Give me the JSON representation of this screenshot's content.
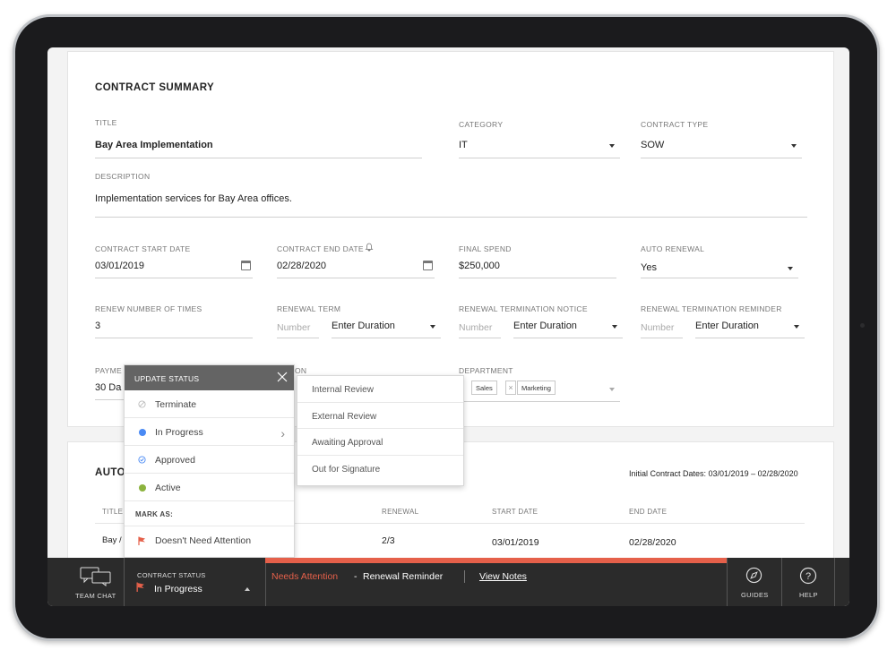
{
  "summary": {
    "heading": "CONTRACT SUMMARY",
    "title": {
      "label": "TITLE",
      "value": "Bay Area Implementation"
    },
    "category": {
      "label": "CATEGORY",
      "value": "IT"
    },
    "contract_type": {
      "label": "CONTRACT TYPE",
      "value": "SOW"
    },
    "description": {
      "label": "DESCRIPTION",
      "value": "Implementation services for Bay Area offices."
    },
    "start_date": {
      "label": "CONTRACT START DATE",
      "value": "03/01/2019"
    },
    "end_date": {
      "label": "CONTRACT END DATE",
      "value": "02/28/2020"
    },
    "final_spend": {
      "label": "FINAL SPEND",
      "value": "$250,000"
    },
    "auto_renewal": {
      "label": "AUTO RENEWAL",
      "value": "Yes"
    },
    "renew_times": {
      "label": "RENEW NUMBER OF TIMES",
      "value": "3"
    },
    "renewal_term": {
      "label": "RENEWAL TERM",
      "number_placeholder": "Number",
      "duration": "Enter Duration"
    },
    "termination_notice": {
      "label": "RENEWAL TERMINATION NOTICE",
      "number_placeholder": "Number",
      "duration": "Enter Duration"
    },
    "termination_reminder": {
      "label": "RENEWAL TERMINATION REMINDER",
      "number_placeholder": "Number",
      "duration": "Enter Duration"
    },
    "payment": {
      "label_partial": "PAYME",
      "value_partial": "30 Da"
    },
    "obscured_label_tail": "ON",
    "department": {
      "label": "DEPARTMENT",
      "tags": [
        "Sales",
        "Marketing"
      ]
    }
  },
  "update_status": {
    "header": "UPDATE STATUS",
    "options": [
      {
        "label": "Terminate",
        "icon": "terminate-icon",
        "color": "#bbbbbb"
      },
      {
        "label": "In Progress",
        "icon": "in-progress-dot",
        "color": "#4a8af4"
      },
      {
        "label": "Approved",
        "icon": "approved-icon",
        "color": "#4a8af4"
      },
      {
        "label": "Active",
        "icon": "active-dot",
        "color": "#8cb33e"
      }
    ],
    "mark_as_label": "MARK AS:",
    "mark_as_option": "Doesn't Need Attention"
  },
  "submenu": [
    "Internal Review",
    "External Review",
    "Awaiting Approval",
    "Out for Signature"
  ],
  "auto_section": {
    "heading_partial": "AUTO",
    "initial_dates": "Initial Contract Dates: 03/01/2019 – 02/28/2020",
    "columns": [
      "TITLE",
      "RENEWAL",
      "START DATE",
      "END DATE"
    ],
    "row": {
      "title_partial": "Bay /",
      "renewal": "2/3",
      "start": "03/01/2019",
      "end": "02/28/2020"
    }
  },
  "bottom_bar": {
    "team_chat": "TEAM CHAT",
    "status_label": "CONTRACT STATUS",
    "status_value": "In Progress",
    "needs_attention": "Needs Attention",
    "separator": "-",
    "reminder": "Renewal Reminder",
    "view_notes": "View Notes",
    "guides": "GUIDES",
    "help": "HELP"
  },
  "colors": {
    "accent": "#e5604a",
    "bar_bg": "#2b2b2b",
    "popup_header": "#646464"
  }
}
